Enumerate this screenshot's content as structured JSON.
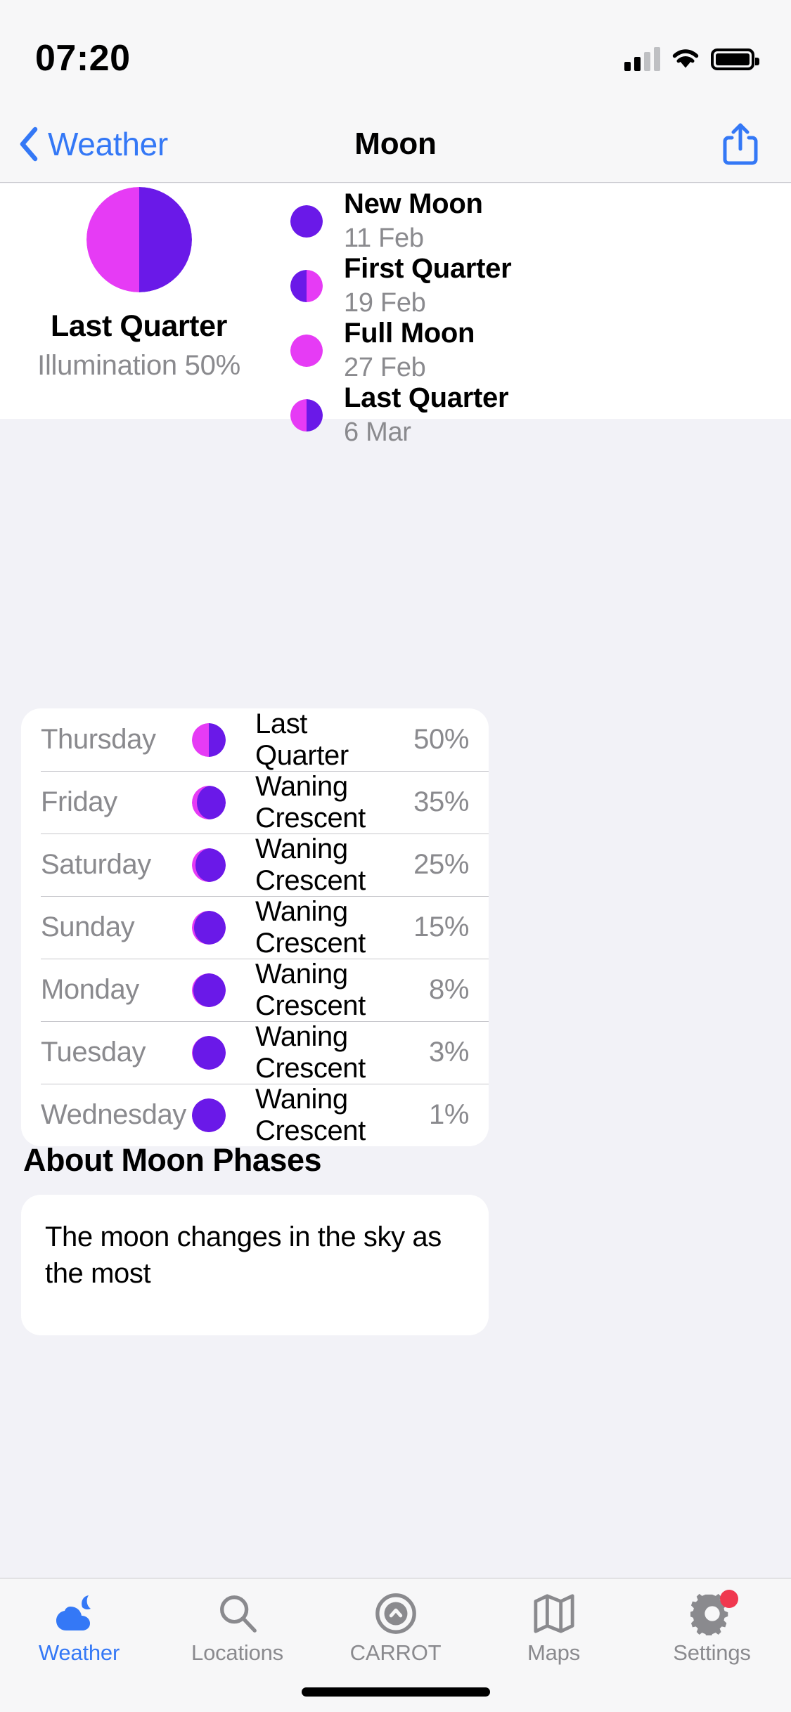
{
  "status_bar": {
    "time": "07:20",
    "cellular_icon": "cellular-signal-icon",
    "wifi_icon": "wifi-icon",
    "battery_icon": "battery-icon"
  },
  "nav_bar": {
    "back_label": "Weather",
    "back_icon": "chevron-left-icon",
    "title": "Moon",
    "share_icon": "share-icon"
  },
  "hero": {
    "phase_name": "Last Quarter",
    "illumination_label": "Illumination 50%",
    "moon_shape": "half-left-lit"
  },
  "upcoming_phases": [
    {
      "name": "New Moon",
      "date": "11 Feb",
      "shape": "full-dark"
    },
    {
      "name": "First Quarter",
      "date": "19 Feb",
      "shape": "half-right-lit"
    },
    {
      "name": "Full Moon",
      "date": "27 Feb",
      "shape": "full-lit"
    },
    {
      "name": "Last Quarter",
      "date": "6 Mar",
      "shape": "half-left-lit"
    }
  ],
  "week_table": {
    "rows": [
      {
        "day": "Thursday",
        "phase": "Last Quarter",
        "illumination": "50%",
        "shape": "half-left-lit"
      },
      {
        "day": "Friday",
        "phase": "Waning Crescent",
        "illumination": "35%",
        "shape": "crescent-35"
      },
      {
        "day": "Saturday",
        "phase": "Waning Crescent",
        "illumination": "25%",
        "shape": "crescent-25"
      },
      {
        "day": "Sunday",
        "phase": "Waning Crescent",
        "illumination": "15%",
        "shape": "crescent-15"
      },
      {
        "day": "Monday",
        "phase": "Waning Crescent",
        "illumination": "8%",
        "shape": "crescent-8"
      },
      {
        "day": "Tuesday",
        "phase": "Waning Crescent",
        "illumination": "3%",
        "shape": "crescent-3"
      },
      {
        "day": "Wednesday",
        "phase": "Waning Crescent",
        "illumination": "1%",
        "shape": "crescent-1"
      }
    ]
  },
  "about": {
    "heading": "About Moon Phases",
    "body": "The moon changes in the sky as the most"
  },
  "tab_bar": {
    "items": [
      {
        "label": "Weather",
        "icon": "cloud-moon-icon",
        "active": true,
        "badge": false
      },
      {
        "label": "Locations",
        "icon": "search-icon",
        "active": false,
        "badge": false
      },
      {
        "label": "CARROT",
        "icon": "carrot-icon",
        "active": false,
        "badge": false
      },
      {
        "label": "Maps",
        "icon": "map-icon",
        "active": false,
        "badge": false
      },
      {
        "label": "Settings",
        "icon": "gear-icon",
        "active": false,
        "badge": true
      }
    ]
  },
  "colors": {
    "lit": "#E63BF5",
    "dark": "#6A19E8",
    "accent": "#3478F6",
    "secondary_text": "#8A8A8E",
    "badge": "#F0384F"
  }
}
